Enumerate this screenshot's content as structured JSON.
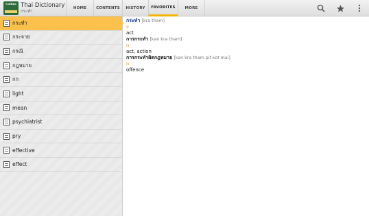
{
  "app": {
    "title": "Thai Dictionary",
    "subtitle": "กระทำ",
    "logo_text": "Collins"
  },
  "tabs": [
    {
      "label": "HOME",
      "active": false
    },
    {
      "label": "CONTENTS",
      "active": false
    },
    {
      "label": "HISTORY",
      "active": false
    },
    {
      "label": "FAVORITES",
      "active": true
    },
    {
      "label": "MORE",
      "active": false
    }
  ],
  "actions": [
    "search-icon",
    "star-icon",
    "overflow-menu-icon"
  ],
  "list": [
    {
      "label": "กระทำ",
      "selected": true
    },
    {
      "label": "กระจาย",
      "selected": false
    },
    {
      "label": "กรณี",
      "selected": false
    },
    {
      "label": "กฎหมาย",
      "selected": false
    },
    {
      "label": "กก",
      "selected": false
    },
    {
      "label": "light",
      "selected": false
    },
    {
      "label": "mean",
      "selected": false
    },
    {
      "label": "psychiatrist",
      "selected": false
    },
    {
      "label": "pry",
      "selected": false
    },
    {
      "label": "effective",
      "selected": false
    },
    {
      "label": "effect",
      "selected": false
    }
  ],
  "entry": {
    "headword": "กระทำ",
    "headword_pron": "[kra tham]",
    "pos1": "v",
    "def1": "act",
    "sub1": "การกระทำ",
    "sub1_pron": "[kan kra tham]",
    "pos2": "n",
    "def2": "act, action",
    "sub2": "การกระทำผิดกฎหมาย",
    "sub2_pron": "[kan kra tham pit kot mai]",
    "pos3": "n",
    "def3": "offence"
  },
  "colors": {
    "accent": "#fcc04c",
    "tab_indicator": "#f4b400",
    "headword": "#1b3a8a",
    "pos": "#d98a1a"
  }
}
